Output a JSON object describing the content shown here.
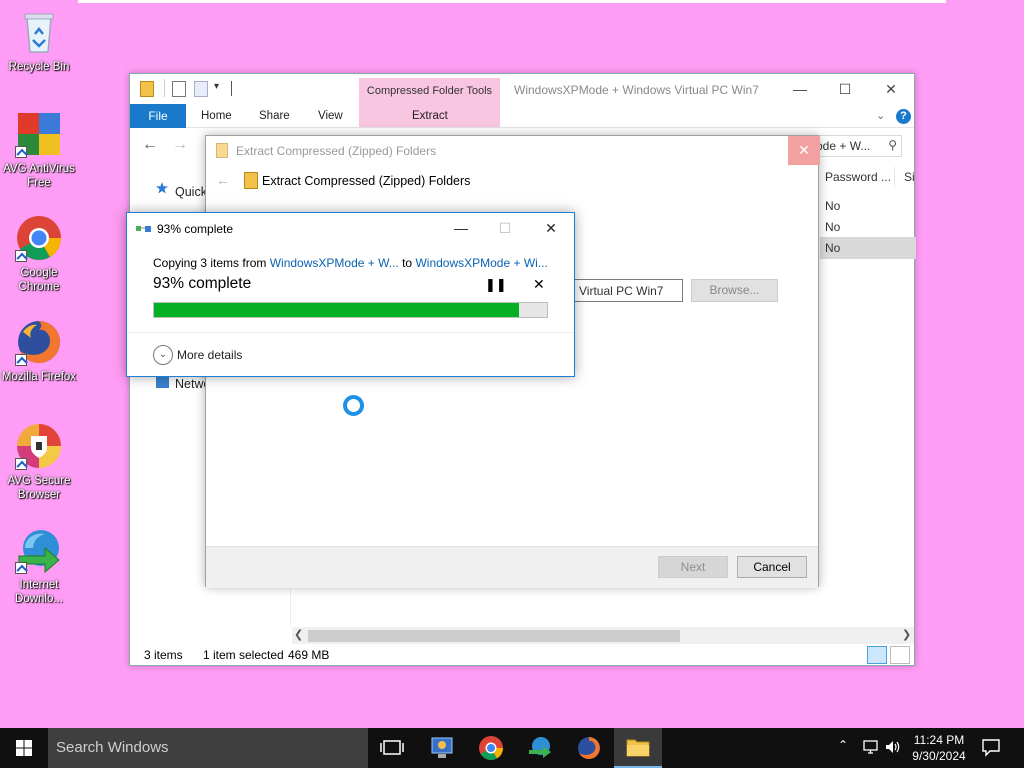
{
  "desktop": {
    "icons": [
      {
        "label": "Recycle Bin"
      },
      {
        "label": "AVG AntiVirus Free"
      },
      {
        "label": "Google Chrome"
      },
      {
        "label": "Mozilla Firefox"
      },
      {
        "label": "AVG Secure Browser"
      },
      {
        "label": "Internet Downlo..."
      }
    ]
  },
  "explorer": {
    "title": "WindowsXPMode + Windows Virtual PC Win7",
    "context_tab": "Compressed Folder Tools",
    "ribbon_tabs": {
      "file": "File",
      "home": "Home",
      "share": "Share",
      "view": "View",
      "extract": "Extract"
    },
    "search_value": "ode + W...",
    "nav_pane": {
      "quick": "Quick",
      "network": "Netwo"
    },
    "columns": {
      "password": "Password ...",
      "size": "Si"
    },
    "rows": [
      "No",
      "No",
      "No"
    ],
    "status": {
      "items": "3 items",
      "selected": "1 item selected",
      "size": "469 MB"
    }
  },
  "wizard": {
    "title": "Extract Compressed (Zipped) Folders",
    "header": "Extract Compressed (Zipped) Folders",
    "path_value": "Virtual PC Win7",
    "browse_label": "Browse...",
    "next_label": "Next",
    "cancel_label": "Cancel"
  },
  "progress": {
    "title": "93% complete",
    "copying_prefix": "Copying 3 items from ",
    "from": "WindowsXPMode + W...",
    "to_word": " to ",
    "to": "WindowsXPMode + Wi...",
    "percent_label": "93% complete",
    "percent_value": 0.93,
    "more_details": "More details"
  },
  "taskbar": {
    "search_placeholder": "Search Windows",
    "time": "11:24 PM",
    "date": "9/30/2024"
  },
  "colors": {
    "desktop_bg": "#ff9cf5",
    "accent_blue": "#1979ca",
    "progress_green": "#06b025",
    "context_tab_pink": "#f9c6e2"
  }
}
